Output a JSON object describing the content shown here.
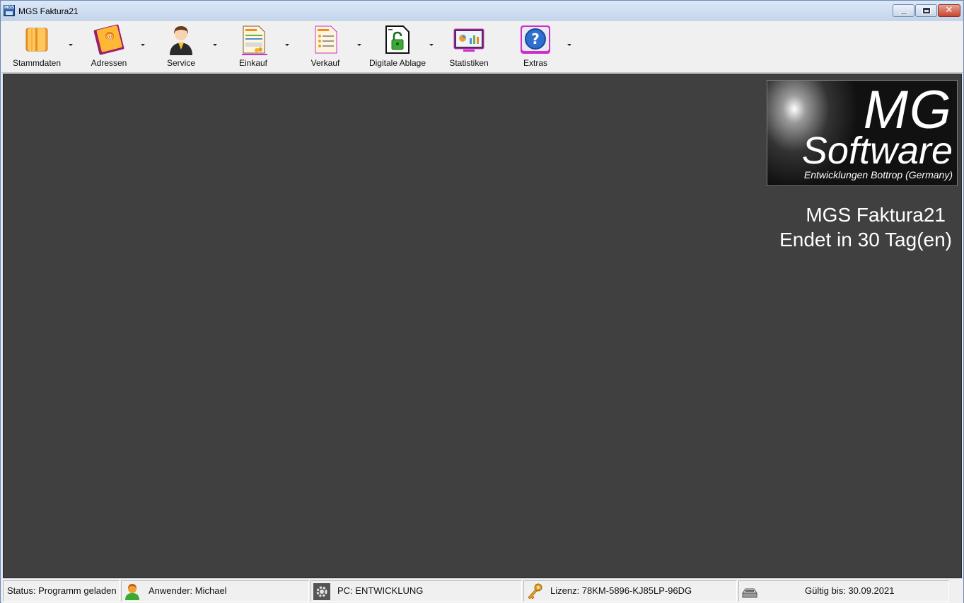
{
  "window": {
    "title": "MGS Faktura21",
    "icon": "mgs-app-icon",
    "controls": [
      "minimize",
      "maximize",
      "close"
    ]
  },
  "toolbar": {
    "items": [
      {
        "label": "Stammdaten",
        "icon": "stammdaten-folder-icon",
        "has_dropdown": true
      },
      {
        "label": "Adressen",
        "icon": "address-book-icon",
        "has_dropdown": true
      },
      {
        "label": "Service",
        "icon": "service-person-icon",
        "has_dropdown": true
      },
      {
        "label": "Einkauf",
        "icon": "purchase-document-icon",
        "has_dropdown": true
      },
      {
        "label": "Verkauf",
        "icon": "sales-document-icon",
        "has_dropdown": true
      },
      {
        "label": "Digitale Ablage",
        "icon": "lock-document-icon",
        "has_dropdown": true
      },
      {
        "label": "Statistiken",
        "icon": "statistics-monitor-icon",
        "has_dropdown": false
      },
      {
        "label": "Extras",
        "icon": "help-question-icon",
        "has_dropdown": true
      }
    ]
  },
  "workspace": {
    "background": "#404040",
    "logo": {
      "line1": "MG",
      "line2": "Software",
      "line3": "Entwicklungen Bottrop (Germany)"
    },
    "trial": {
      "line1": "MGS Faktura21",
      "line2": "Endet in 30 Tag(en)"
    }
  },
  "statusbar": {
    "status": "Status: Programm geladen",
    "user": "Anwender: Michael",
    "pc": "PC: ENTWICKLUNG",
    "license": "Lizenz: 78KM-5896-KJ85LP-96DG",
    "valid_until": "Gültig bis: 30.09.2021",
    "icons": [
      "user-icon",
      "gear-icon",
      "key-icon",
      "scanner-icon"
    ]
  }
}
